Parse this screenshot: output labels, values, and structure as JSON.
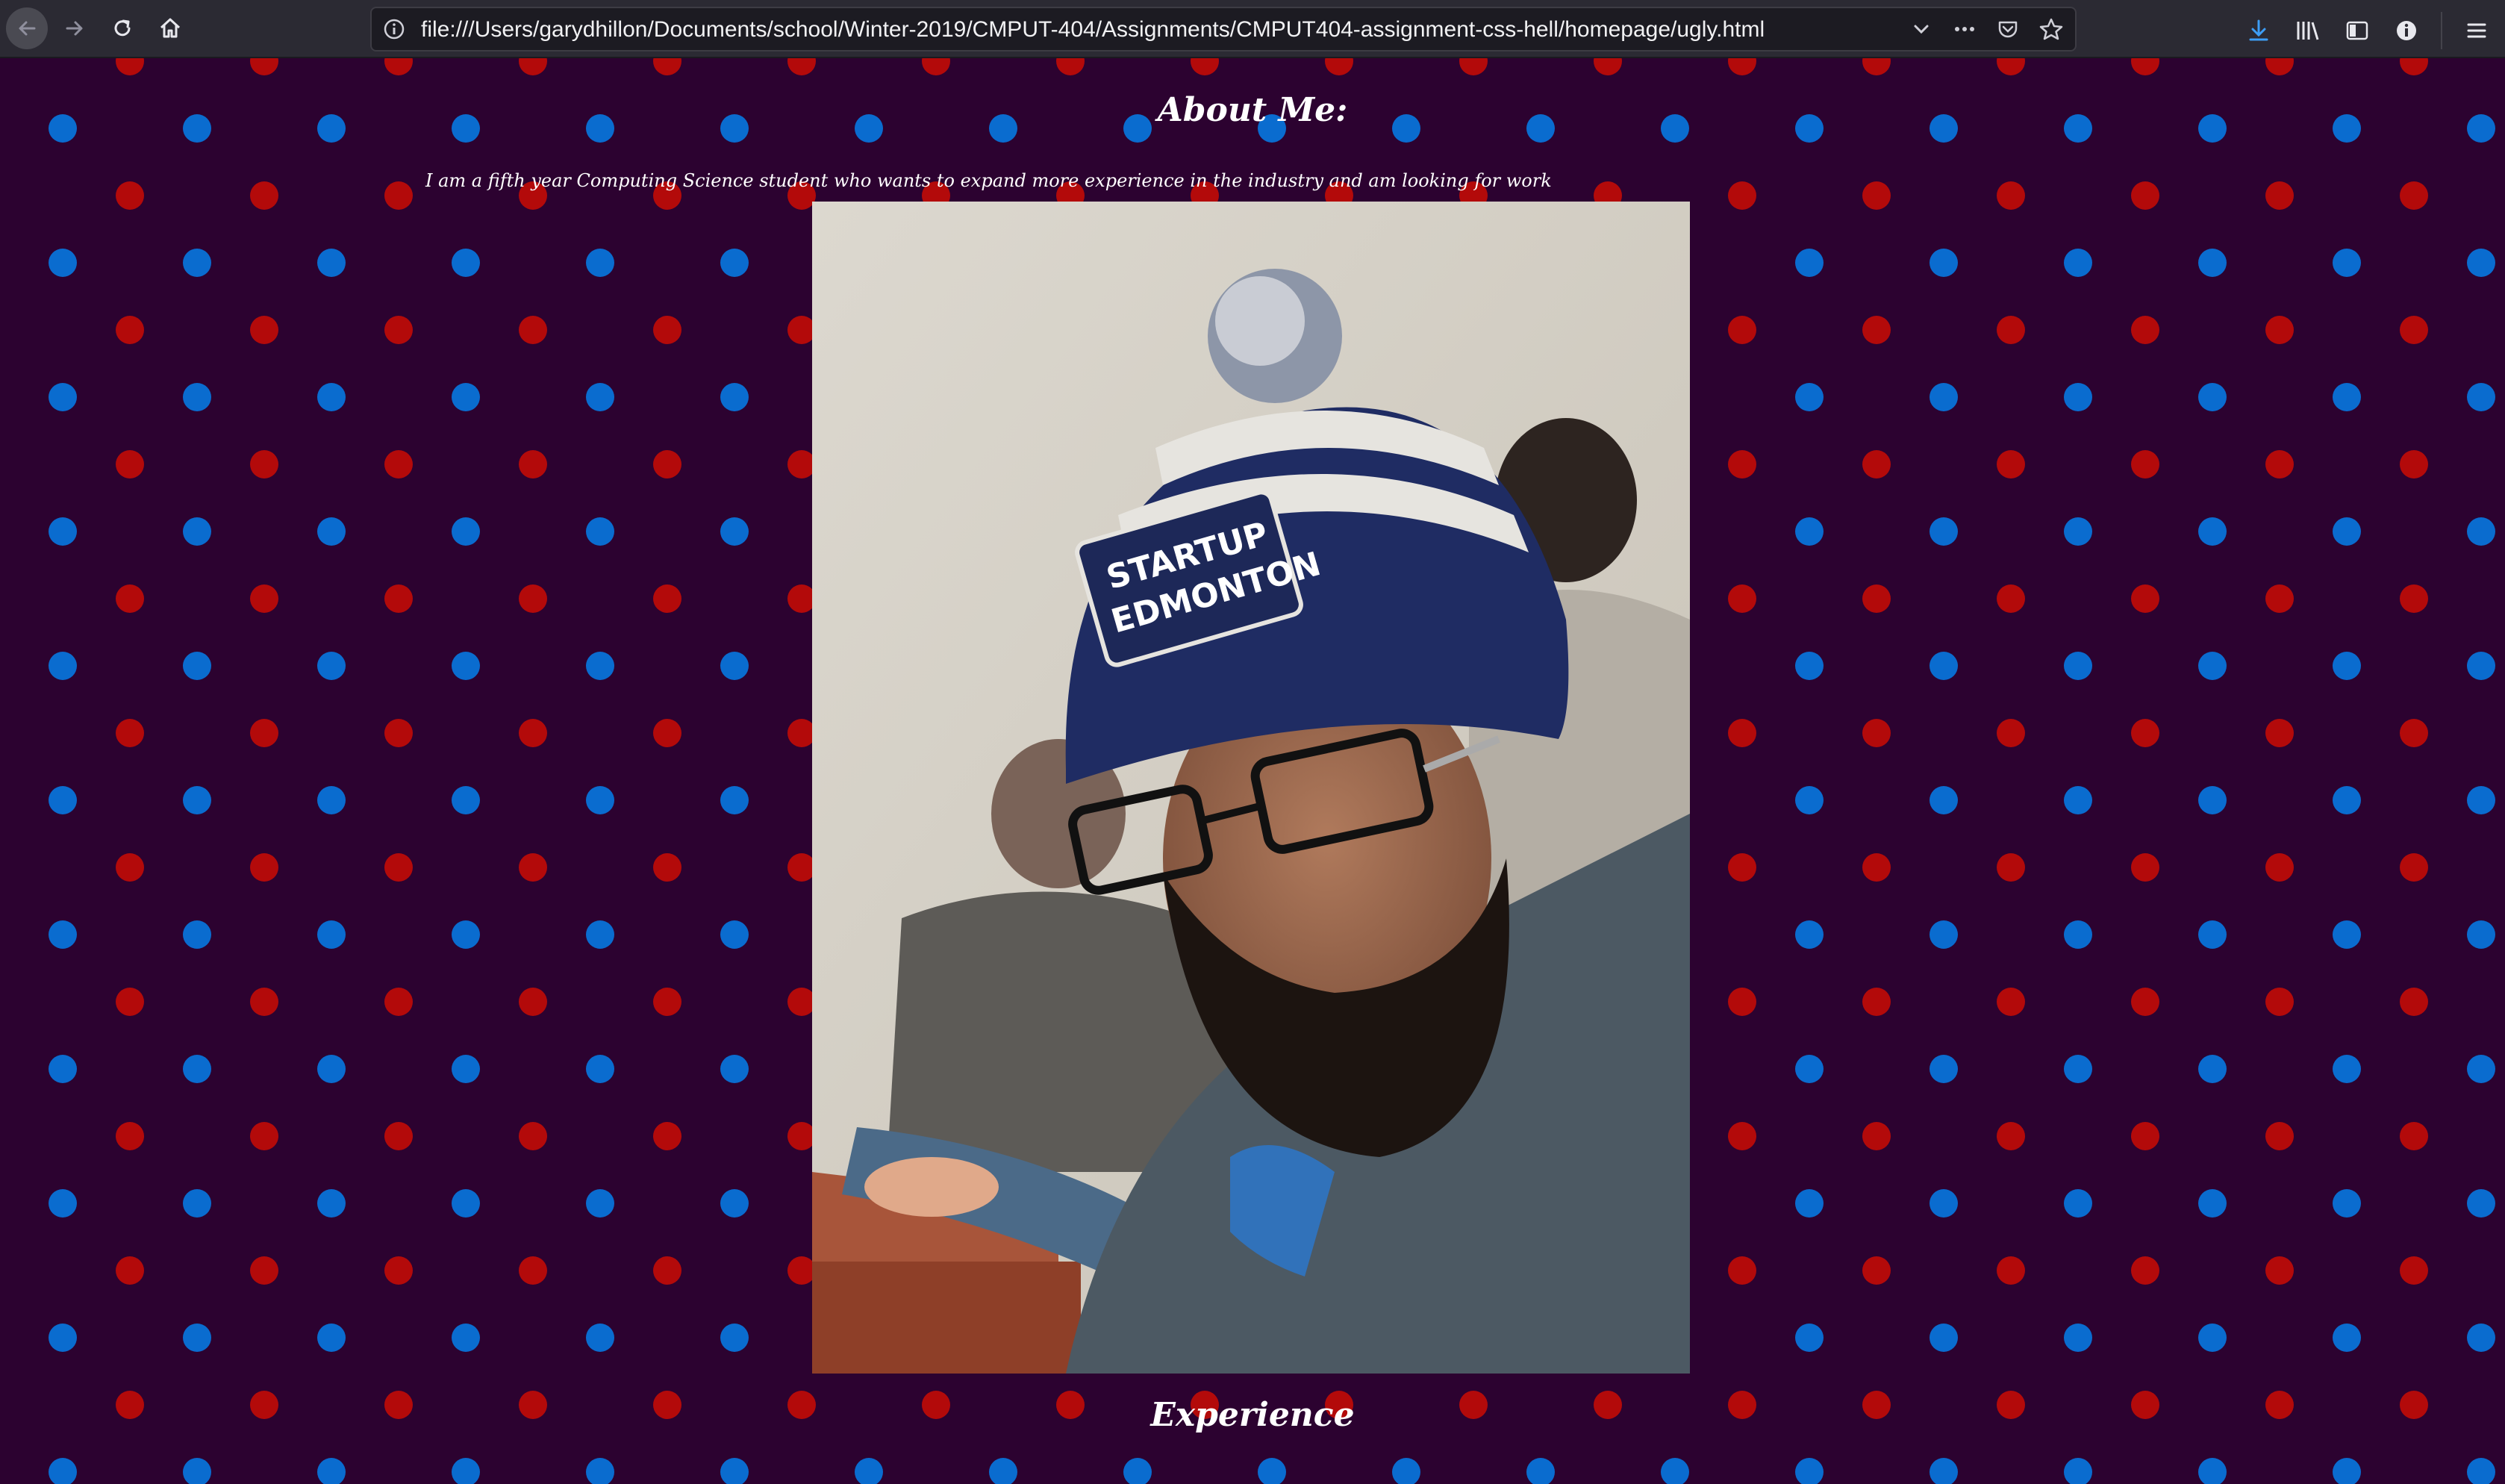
{
  "browser": {
    "url": "file:///Users/garydhillon/Documents/school/Winter-2019/CMPUT-404/Assignments/CMPUT404-assignment-css-hell/homepage/ugly.html",
    "icons": {
      "back": "back-arrow-icon",
      "forward": "forward-arrow-icon",
      "reload": "reload-icon",
      "home": "home-icon",
      "info": "info-icon",
      "dropdown": "chevron-down-icon",
      "more": "more-actions-icon",
      "pocket": "pocket-icon",
      "bookmark": "star-icon",
      "download": "download-icon",
      "library": "library-icon",
      "sidebar": "sidebar-icon",
      "extension": "extension-icon",
      "menu": "hamburger-menu-icon"
    }
  },
  "page": {
    "about_heading": "About Me:",
    "intro_text": "I am a fifth year Computing Science student who wants to expand more experience in the industry and am looking for work",
    "experience_heading": "Experience",
    "photo_description": "",
    "colors": {
      "background": "#2c0230",
      "dot_blue": "#0a6ccf",
      "dot_red": "#b30a0a",
      "heading_text": "#ffffff"
    }
  }
}
